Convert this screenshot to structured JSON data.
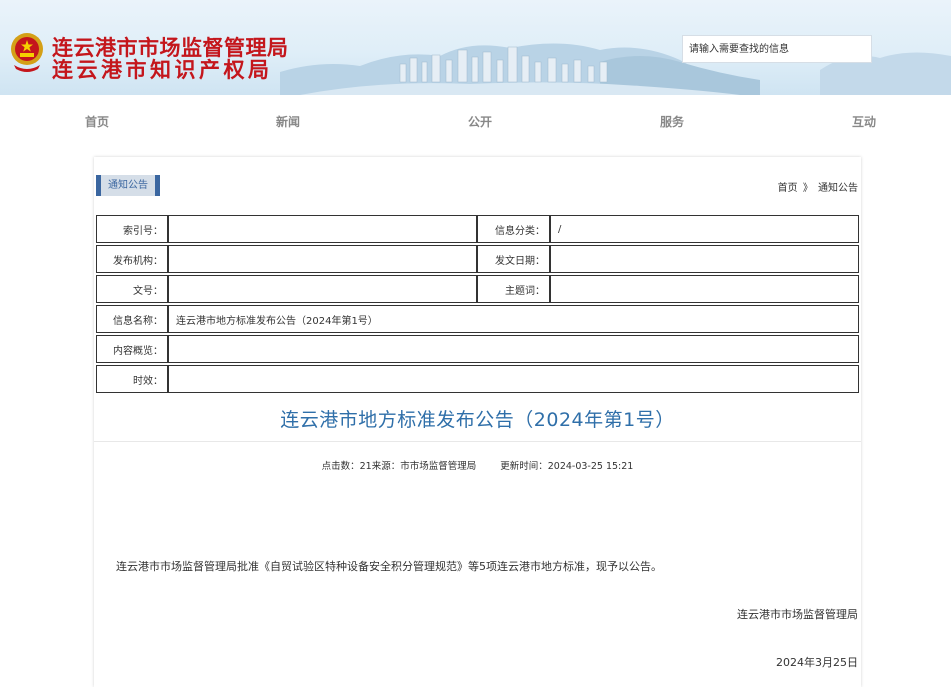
{
  "header": {
    "title_line1": "连云港市市场监督管理局",
    "title_line2": "连云港市知识产权局",
    "emblem_icon": "national-emblem-icon",
    "title_color": "#c4161c"
  },
  "search": {
    "placeholder": "请输入需要查找的信息"
  },
  "nav": [
    "首页",
    "新闻",
    "公开",
    "服务",
    "互动"
  ],
  "panel": {
    "tab_label": "通知公告",
    "breadcrumb": {
      "home": "首页",
      "separator": "》",
      "current": "通知公告"
    }
  },
  "meta": {
    "index_label": "索引号：",
    "index_value": "",
    "category_label": "信息分类：",
    "category_value": "/",
    "publisher_label": "发布机构：",
    "publisher_value": "",
    "date_label": "发文日期：",
    "date_value": "",
    "docno_label": "文号：",
    "docno_value": "",
    "subject_label": "主题词：",
    "subject_value": "",
    "name_label": "信息名称：",
    "name_value": "连云港市地方标准发布公告（2024年第1号）",
    "summary_label": "内容概览：",
    "summary_value": "",
    "validity_label": "时效：",
    "validity_value": ""
  },
  "article": {
    "title": "连云港市地方标准发布公告（2024年第1号）",
    "stats": "点击数：21来源：市市场监督管理局",
    "updated": "更新时间：2024-03-25 15:21",
    "body": "连云港市市场监督管理局批准《自贸试验区特种设备安全积分管理规范》等5项连云港市地方标准，现予以公告。",
    "signature": "连云港市市场监督管理局",
    "date": "2024年3月25日"
  },
  "colors": {
    "accent": "#2f6fa9",
    "tab_border": "#3a66a0",
    "nav_text": "#888888"
  }
}
